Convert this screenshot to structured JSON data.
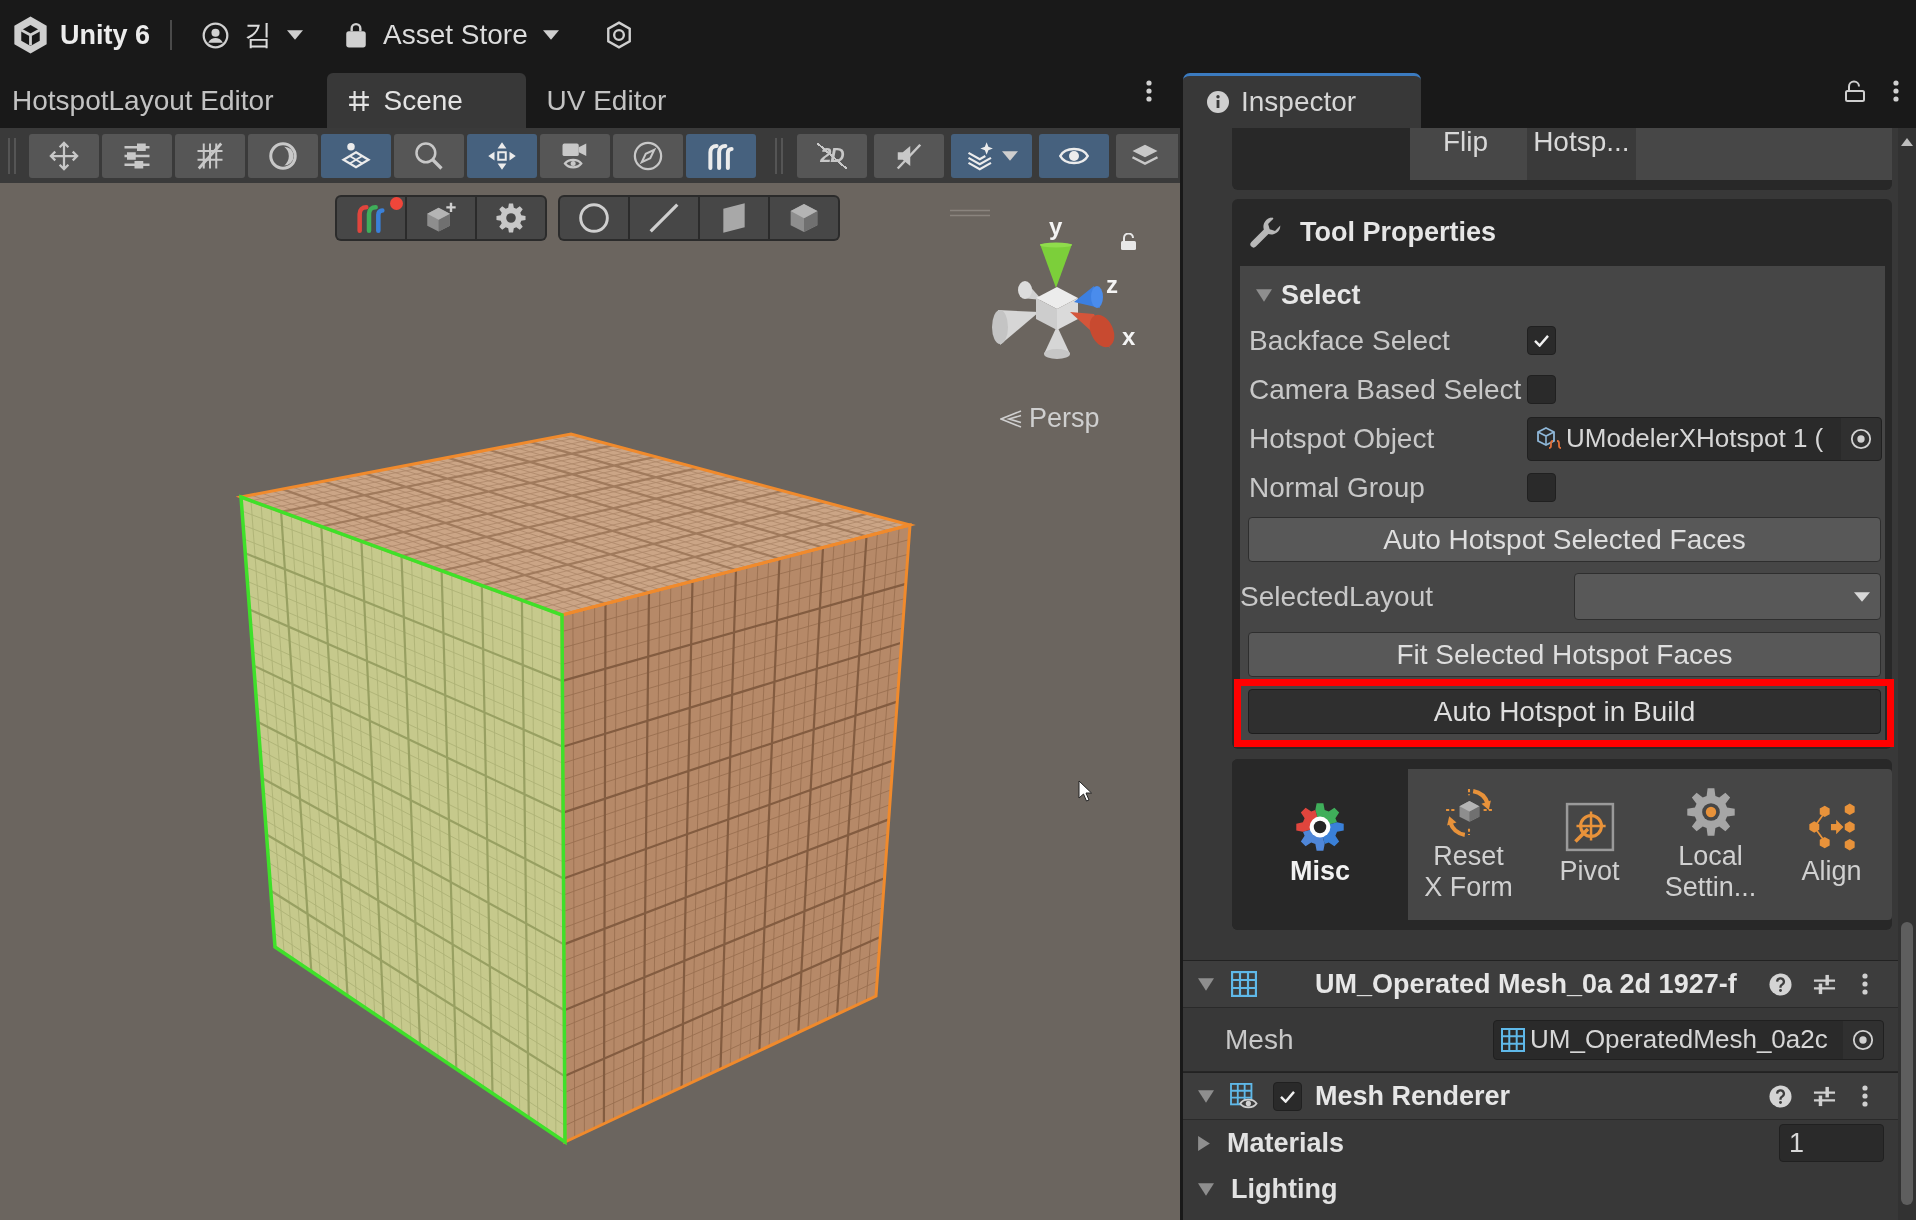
{
  "title_bar": {
    "product": "Unity 6",
    "account": "김",
    "store": "Asset Store"
  },
  "scene_panel": {
    "tabs": [
      {
        "label": "HotspotLayout Editor",
        "kind": "editor",
        "selected": false
      },
      {
        "label": "Scene",
        "kind": "scene",
        "selected": true
      },
      {
        "label": "UV Editor",
        "kind": "editor",
        "selected": false
      }
    ],
    "toolbar_groups": [
      {
        "tools": [
          {
            "kind": "move",
            "selected": false
          },
          {
            "kind": "sliders",
            "selected": false
          },
          {
            "kind": "grid",
            "selected": false
          },
          {
            "kind": "shading",
            "selected": false
          },
          {
            "kind": "plane",
            "selected": true
          },
          {
            "kind": "search",
            "selected": false
          },
          {
            "kind": "pivot",
            "selected": true
          },
          {
            "kind": "camera",
            "selected": false
          },
          {
            "kind": "compass",
            "selected": false
          },
          {
            "kind": "logo",
            "selected": true
          }
        ]
      },
      {
        "tools": [
          {
            "kind": "mode2d",
            "label": "2D",
            "selected": false
          },
          {
            "kind": "audio",
            "selected": false
          },
          {
            "kind": "effects",
            "selected": true
          },
          {
            "kind": "visibility",
            "selected": true
          },
          {
            "kind": "layers",
            "selected": false
          }
        ]
      }
    ],
    "overlay_toolbars": [
      {
        "tools": [
          {
            "kind": "logo",
            "notification": true
          },
          {
            "kind": "add_cube",
            "notification": false
          },
          {
            "kind": "settings",
            "notification": false
          }
        ]
      },
      {
        "tools": [
          {
            "kind": "vertex",
            "notification": false
          },
          {
            "kind": "edge",
            "notification": false
          },
          {
            "kind": "face",
            "notification": false
          },
          {
            "kind": "object",
            "notification": false
          }
        ]
      }
    ],
    "gizmo": {
      "axis_labels": [
        "y",
        "z",
        "x"
      ],
      "projection": "Persp"
    }
  },
  "inspector": {
    "tab": "Inspector",
    "mode_tabs": [
      {
        "label": "Flip",
        "selected": false
      },
      {
        "label": "Hotsp...",
        "selected": true
      }
    ],
    "tool_properties": {
      "title": "Tool Properties",
      "section": {
        "label": "Select",
        "expanded": true
      },
      "fields": [
        {
          "kind": "checkbox",
          "label": "Backface Select",
          "checked": true
        },
        {
          "kind": "checkbox",
          "label": "Camera Based Select",
          "checked": false
        },
        {
          "kind": "object",
          "label": "Hotspot Object",
          "value": "UModelerXHotspot 1 ("
        },
        {
          "kind": "checkbox",
          "label": "Normal Group",
          "checked": false
        },
        {
          "kind": "button",
          "label": "Auto Hotspot Selected Faces",
          "highlighted": false,
          "hovered": false
        },
        {
          "kind": "dropdown",
          "label": "SelectedLayout"
        },
        {
          "kind": "button",
          "label": "Fit Selected Hotspot Faces",
          "highlighted": false,
          "hovered": false
        },
        {
          "kind": "button",
          "label": "Auto Hotspot in Build",
          "highlighted": true,
          "hovered": true
        }
      ]
    },
    "categories": [
      {
        "kind": "misc",
        "label": "Misc",
        "selected": true
      },
      {
        "kind": "reset",
        "label": "Reset X Form",
        "selected": false
      },
      {
        "kind": "pivot",
        "label": "Pivot",
        "selected": false
      },
      {
        "kind": "settings",
        "label": "Local Settin...",
        "selected": false
      },
      {
        "kind": "align",
        "label": "Align",
        "selected": false
      }
    ],
    "components": [
      {
        "kind": "mesh_filter",
        "title": "UM_Operated Mesh_0a 2d 1927-f",
        "expanded": true,
        "properties": [
          {
            "kind": "object",
            "label": "Mesh",
            "value": "UM_OperatedMesh_0a2c"
          }
        ]
      },
      {
        "kind": "mesh_renderer",
        "title": "Mesh Renderer",
        "expanded": true,
        "enabled": true,
        "properties": [
          {
            "kind": "foldout",
            "label": "Materials",
            "expanded": false,
            "value": "1"
          },
          {
            "kind": "foldout",
            "label": "Lighting",
            "expanded": true
          }
        ]
      }
    ]
  }
}
